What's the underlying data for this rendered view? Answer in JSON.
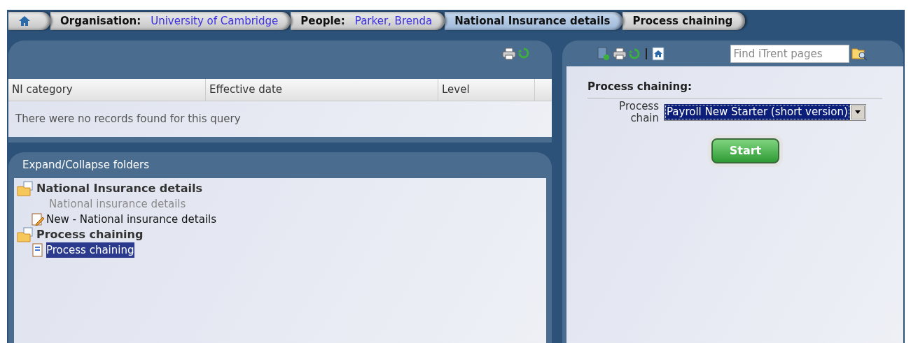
{
  "breadcrumbs": [
    {
      "kind": "home",
      "selected": false
    },
    {
      "kind": "pair",
      "label": "Organisation:",
      "value": "University of Cambridge",
      "selected": false
    },
    {
      "kind": "pair",
      "label": "People:",
      "value": "Parker, Brenda",
      "selected": false
    },
    {
      "kind": "plain",
      "label": "National Insurance details",
      "selected": true
    },
    {
      "kind": "plain",
      "label": "Process chaining",
      "selected": false
    }
  ],
  "records_table": {
    "columns": [
      "NI category",
      "Effective date",
      "Level"
    ],
    "empty_message": "There were no records found for this query"
  },
  "tree": {
    "header": "Expand/Collapse folders",
    "folders": [
      {
        "label": "National Insurance details",
        "children": [
          {
            "label": "National insurance details",
            "kind": "text",
            "disabled": true,
            "selected": false
          },
          {
            "label": "New - National insurance details",
            "kind": "new",
            "disabled": false,
            "selected": false
          }
        ]
      },
      {
        "label": "Process chaining",
        "children": [
          {
            "label": "Process chaining",
            "kind": "page",
            "disabled": false,
            "selected": true
          }
        ]
      }
    ]
  },
  "search": {
    "placeholder": "Find iTrent pages"
  },
  "form": {
    "title": "Process chaining:",
    "field_label": "Process chain",
    "select_value": "Payroll New Starter (short version)",
    "button": "Start"
  }
}
